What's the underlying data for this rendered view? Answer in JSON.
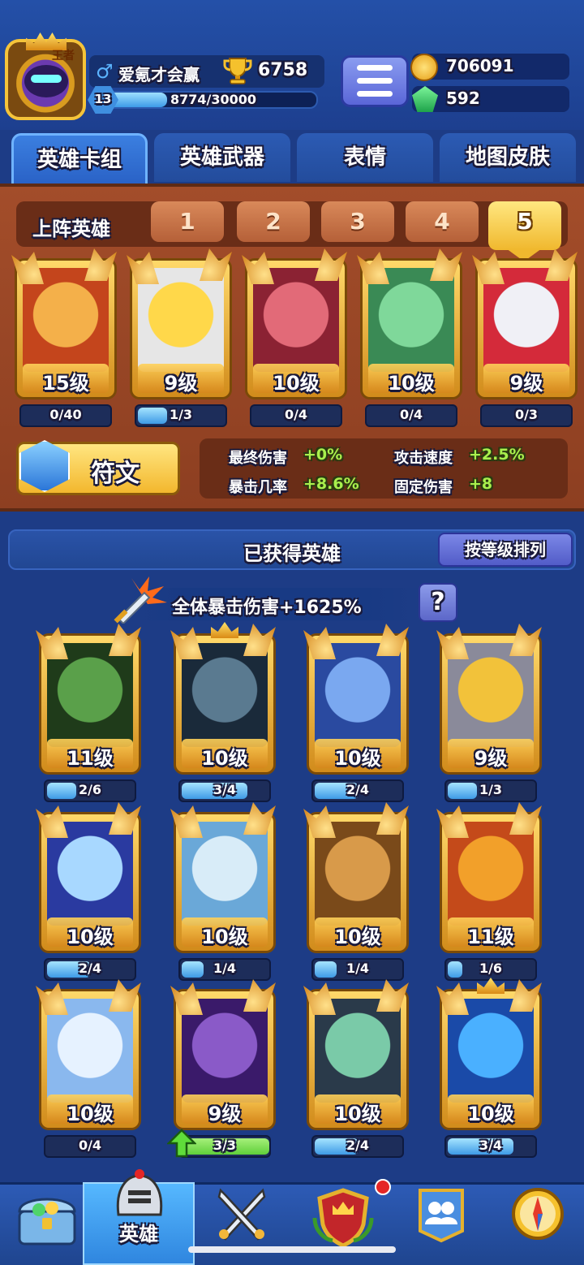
{
  "player": {
    "avatar_title": "王者",
    "gender_symbol": "♂",
    "name": "爱氪才会赢",
    "trophies": "6758",
    "level": "13",
    "xp_text": "8774/30000",
    "xp_fraction": 0.29
  },
  "currency": {
    "gold": "706091",
    "gems": "592"
  },
  "tabs": [
    {
      "label": "英雄卡组",
      "active": true
    },
    {
      "label": "英雄武器",
      "active": false
    },
    {
      "label": "表情",
      "active": false
    },
    {
      "label": "地图皮肤",
      "active": false
    }
  ],
  "deck": {
    "label": "上阵英雄",
    "slots": [
      "1",
      "2",
      "3",
      "4",
      "5"
    ],
    "active_slot": "5",
    "heroes": [
      {
        "level": "15级",
        "progress": "0/40",
        "fill": 0,
        "art": "monkey-king"
      },
      {
        "level": "9级",
        "progress": "1/3",
        "fill": 0.33,
        "art": "chef"
      },
      {
        "level": "10级",
        "progress": "0/4",
        "fill": 0,
        "art": "pig"
      },
      {
        "level": "10级",
        "progress": "0/4",
        "fill": 0,
        "art": "zombie-doctor"
      },
      {
        "level": "9级",
        "progress": "0/3",
        "fill": 0,
        "art": "clown"
      }
    ]
  },
  "rune": {
    "label": "符文",
    "stats": [
      {
        "label": "最终伤害",
        "value": "+0%"
      },
      {
        "label": "攻击速度",
        "value": "+2.5%"
      },
      {
        "label": "暴击几率",
        "value": "+8.6%"
      },
      {
        "label": "固定伤害",
        "value": "+8"
      }
    ]
  },
  "collection": {
    "title": "已获得英雄",
    "sort_label": "按等级排列",
    "crit_bonus": "全体暴击伤害+1625%",
    "help_label": "?",
    "heroes": [
      {
        "level": "11级",
        "progress": "2/6",
        "fill": 0.33,
        "art": "goblin"
      },
      {
        "level": "10级",
        "progress": "3/4",
        "fill": 0.75,
        "art": "skeleton-knight",
        "crown": true
      },
      {
        "level": "10级",
        "progress": "2/4",
        "fill": 0.5,
        "art": "yeti-warrior"
      },
      {
        "level": "9级",
        "progress": "1/3",
        "fill": 0.33,
        "art": "gladiator"
      },
      {
        "level": "10级",
        "progress": "2/4",
        "fill": 0.5,
        "art": "girl-mage"
      },
      {
        "level": "10级",
        "progress": "1/4",
        "fill": 0.25,
        "art": "zeus"
      },
      {
        "level": "10级",
        "progress": "1/4",
        "fill": 0.25,
        "art": "cowboy"
      },
      {
        "level": "11级",
        "progress": "1/6",
        "fill": 0.17,
        "art": "ninja"
      },
      {
        "level": "10级",
        "progress": "0/4",
        "fill": 0,
        "art": "snow-yeti"
      },
      {
        "level": "9级",
        "progress": "3/3",
        "fill": 1.0,
        "art": "octopus-pirate",
        "upgrade": true
      },
      {
        "level": "10级",
        "progress": "2/4",
        "fill": 0.5,
        "art": "agent"
      },
      {
        "level": "10级",
        "progress": "3/4",
        "fill": 0.75,
        "art": "ice-golem",
        "crown": true
      }
    ]
  },
  "nav": {
    "items": [
      {
        "icon": "treasure-chest-icon"
      },
      {
        "icon": "knight-helmet-icon",
        "label": "英雄",
        "active": true
      },
      {
        "icon": "crossed-swords-icon"
      },
      {
        "icon": "clan-shield-icon",
        "notification": true
      },
      {
        "icon": "friends-banner-icon"
      },
      {
        "icon": "compass-icon"
      }
    ]
  },
  "colors": {
    "background": "#1d3c86",
    "deck_panel": "#a34d2a",
    "gold": "#f3b72d",
    "progress_blue": "#3e9ae6",
    "progress_green": "#5fcf3a",
    "stat_green": "#a9f04d"
  }
}
